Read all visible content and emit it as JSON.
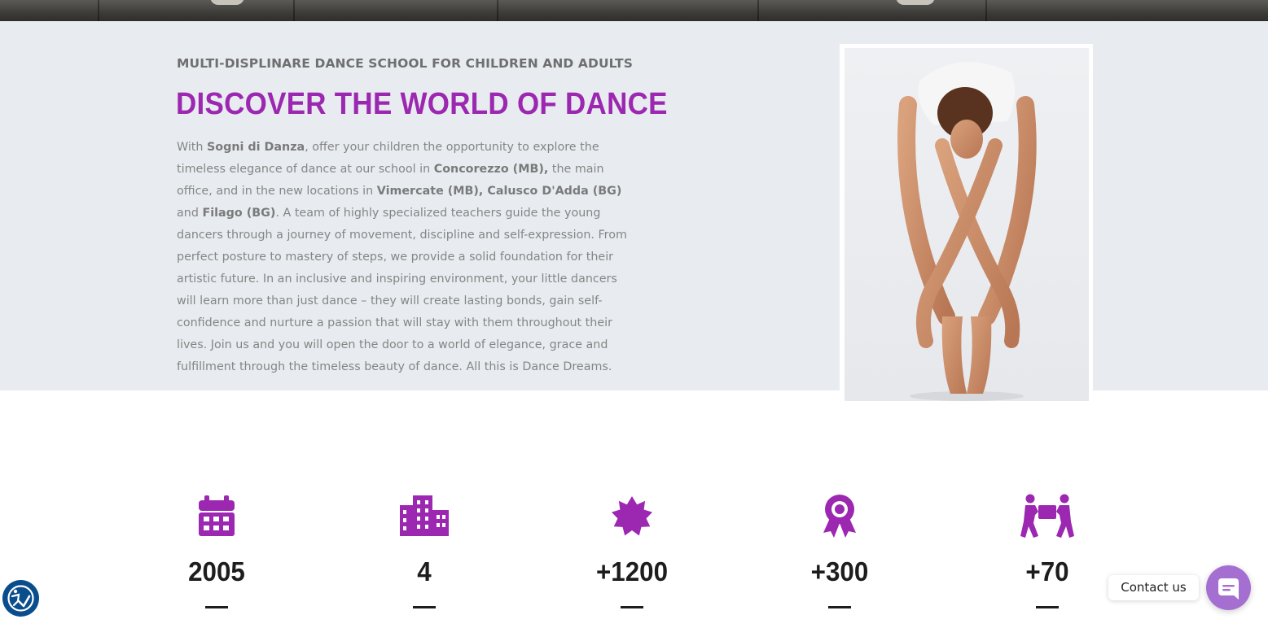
{
  "intro": {
    "eyebrow": "MULTI-DISPLINARE DANCE SCHOOL FOR CHILDREN AND ADULTS",
    "headline": "DISCOVER THE WORLD OF DANCE",
    "paragraph": [
      {
        "t": "With ",
        "b": false
      },
      {
        "t": "Sogni di Danza",
        "b": true
      },
      {
        "t": ", offer your children the opportunity to explore the timeless elegance of dance at our school in ",
        "b": false
      },
      {
        "t": "Concorezzo (MB),",
        "b": true
      },
      {
        "t": " the main office, and in the new locations in ",
        "b": false
      },
      {
        "t": "Vimercate (MB), Calusco D'Adda (BG)",
        "b": true
      },
      {
        "t": " and ",
        "b": false
      },
      {
        "t": "Filago (BG)",
        "b": true
      },
      {
        "t": ". A team of highly specialized teachers guide the young dancers through a journey of movement, discipline and self-expression. From perfect posture to mastery of steps, we provide a solid foundation for their artistic future. In an inclusive and inspiring environment, your little dancers will learn more than just dance – they will create lasting bonds, gain self-confidence and nurture a passion that will stay with them throughout their lives. Join us and you will open the door to a world of elegance, grace and fulfillment through the timeless beauty of dance. All this is Dance Dreams.",
        "b": false
      }
    ],
    "photo_icon": "dancer-photo"
  },
  "stats": [
    {
      "icon": "calendar-icon",
      "value": "2005"
    },
    {
      "icon": "building-icon",
      "value": "4"
    },
    {
      "icon": "badge-icon",
      "value": "+1200"
    },
    {
      "icon": "award-icon",
      "value": "+300"
    },
    {
      "icon": "people-carry-icon",
      "value": "+70"
    }
  ],
  "widgets": {
    "accessibility_icon": "accessibility-icon",
    "contact_label": "Contact us",
    "contact_icon": "chat-icon"
  },
  "colors": {
    "accent": "#9c27b0",
    "intro_bg": "#e8ecf0",
    "contact_button": "#a46fd0",
    "accessibility_button": "#0a4d8c"
  }
}
